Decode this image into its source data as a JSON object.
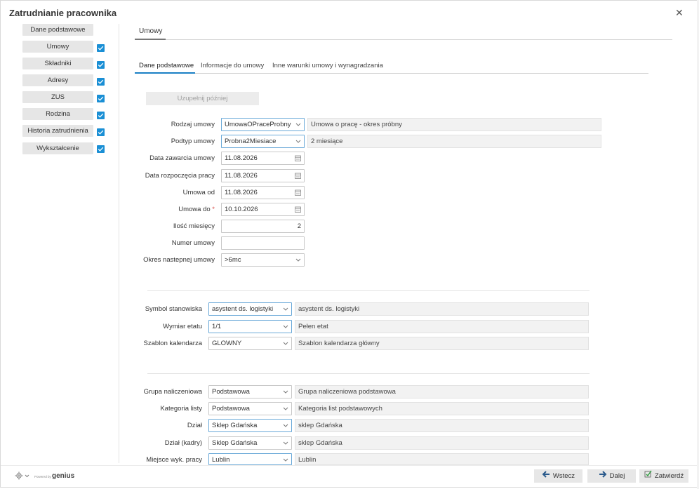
{
  "window": {
    "title": "Zatrudnianie pracownika"
  },
  "sidebar": {
    "items": [
      {
        "label": "Dane podstawowe",
        "checked": false
      },
      {
        "label": "Umowy",
        "checked": true
      },
      {
        "label": "Składniki",
        "checked": true
      },
      {
        "label": "Adresy",
        "checked": true
      },
      {
        "label": "ZUS",
        "checked": true
      },
      {
        "label": "Rodzina",
        "checked": true
      },
      {
        "label": "Historia zatrudnienia",
        "checked": true
      },
      {
        "label": "Wykształcenie",
        "checked": true
      }
    ]
  },
  "section_tab": "Umowy",
  "tabs": [
    "Dane podstawowe",
    "Informacje do umowy",
    "Inne warunki umowy i wynagradzania"
  ],
  "fill_later_button": "Uzupełnij później",
  "contract": {
    "rodzaj_label": "Rodzaj umowy",
    "rodzaj_value": "UmowaOPraceProbny",
    "rodzaj_desc": "Umowa o pracę - okres próbny",
    "podtyp_label": "Podtyp umowy",
    "podtyp_value": "Probna2Miesiace",
    "podtyp_desc": "2 miesiące",
    "data_zawarcia_label": "Data zawarcia umowy",
    "data_zawarcia_value": "11.08.2026",
    "data_rozpoczecia_label": "Data rozpoczęcia pracy",
    "data_rozpoczecia_value": "11.08.2026",
    "umowa_od_label": "Umowa od",
    "umowa_od_value": "11.08.2026",
    "umowa_do_label": "Umowa do",
    "umowa_do_value": "10.10.2026",
    "required_mark": "*",
    "ilosc_label": "Ilość miesięcy",
    "ilosc_value": "2",
    "numer_label": "Numer umowy",
    "numer_value": "",
    "okres_label": "Okres nastepnej umowy",
    "okres_value": ">6mc"
  },
  "position": {
    "symbol_label": "Symbol stanowiska",
    "symbol_value": "asystent ds. logistyki",
    "symbol_desc": "asystent ds. logistyki",
    "wymiar_label": "Wymiar etatu",
    "wymiar_value": "1/1",
    "wymiar_desc": "Pełen etat",
    "szablon_label": "Szablon kalendarza",
    "szablon_value": "GLOWNY",
    "szablon_desc": "Szablon kalendarza główny"
  },
  "payroll": {
    "grupa_label": "Grupa naliczeniowa",
    "grupa_value": "Podstawowa",
    "grupa_desc": "Grupa naliczeniowa podstawowa",
    "kategoria_label": "Kategoria listy",
    "kategoria_value": "Podstawowa",
    "kategoria_desc": "Kategoria list podstawowych",
    "dzial_label": "Dział",
    "dzial_value": "Sklep Gdańska",
    "dzial_desc": "sklep Gdańska",
    "dzial_kadry_label": "Dział (kadry)",
    "dzial_kadry_value": "Sklep Gdańska",
    "dzial_kadry_desc": "sklep Gdańska",
    "miejsce_label": "Miejsce wyk. pracy",
    "miejsce_value": "Lublin",
    "miejsce_desc": "Lublin"
  },
  "footer": {
    "powered_by": "Powered by",
    "brand": "genius",
    "back_label": "Wstecz",
    "next_label": "Dalej",
    "confirm_label": "Zatwierdź"
  },
  "colors": {
    "accent": "#1a8fd5",
    "tab_indicator": "#1a7fc4"
  }
}
